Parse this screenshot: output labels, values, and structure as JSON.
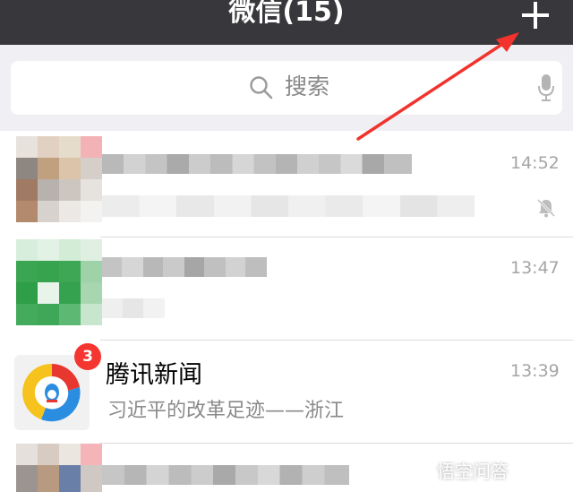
{
  "header": {
    "title": "微信(15)",
    "add_icon": "plus-icon"
  },
  "search": {
    "placeholder": "搜索",
    "search_icon": "search-icon",
    "voice_icon": "microphone-icon"
  },
  "chats": [
    {
      "name": "",
      "preview": "",
      "time": "14:52",
      "muted": true,
      "muted_icon": "muted-bell-icon"
    },
    {
      "name": "",
      "preview": "",
      "time": "13:47"
    },
    {
      "name": "腾讯新闻",
      "preview": "习近平的改革足迹——浙江",
      "time": "13:39",
      "unread": "3"
    },
    {
      "name": "",
      "preview": "",
      "time": ""
    }
  ],
  "colors": {
    "header_bg": "#38373c",
    "search_bg": "#efeff4",
    "badge": "#f43530",
    "annotation_arrow": "#f2322c"
  },
  "watermark": {
    "text": "悟空问答"
  }
}
